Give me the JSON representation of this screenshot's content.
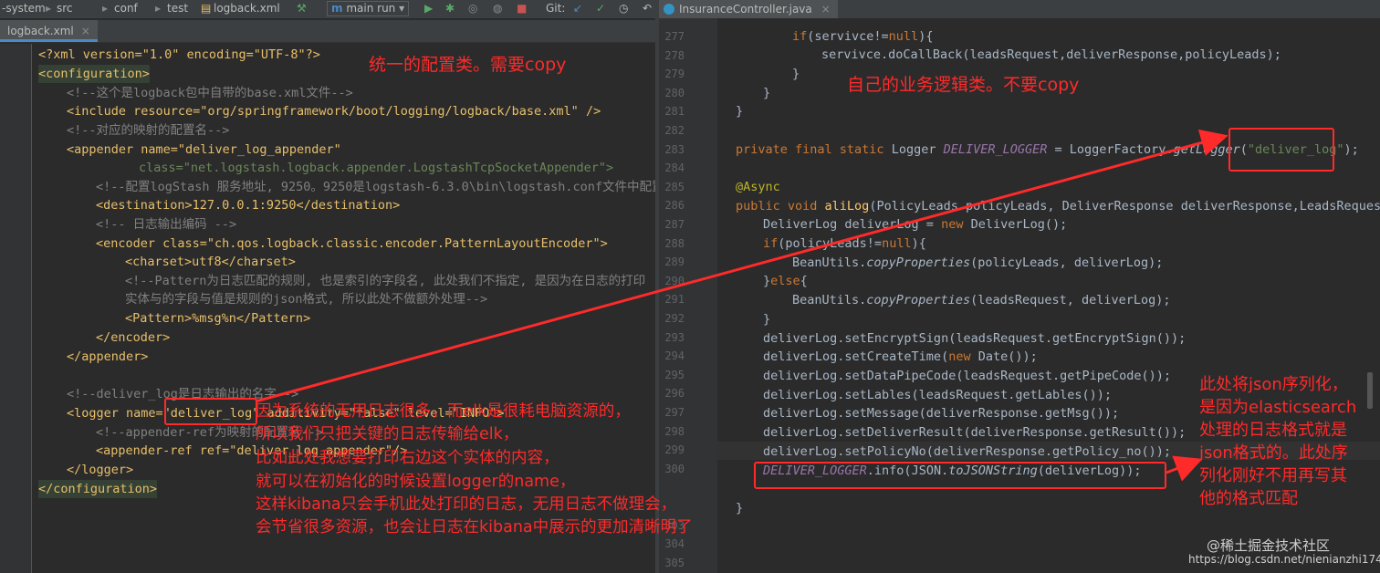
{
  "toolbar": {
    "project": "-system",
    "crumbs": [
      "src",
      "conf",
      "test"
    ],
    "file": "logback.xml",
    "run_config": "main run",
    "git_label": "Git:"
  },
  "left_tab": {
    "label": "logback.xml"
  },
  "right_tab": {
    "label": "InsuranceController.java"
  },
  "left_code": [
    "<?xml version=\"1.0\" encoding=\"UTF-8\"?>",
    "<configuration>",
    "<!--这个是logback包中自带的base.xml文件-->",
    "<include resource=\"org/springframework/boot/logging/logback/base.xml\" />",
    "<!--对应的映射的配置名-->",
    "<appender name=\"deliver_log_appender\"",
    "class=\"net.logstash.logback.appender.LogstashTcpSocketAppender\">",
    "<!--配置logStash 服务地址, 9250。9250是logstash-6.3.0\\bin\\logstash.conf文件中配置",
    "<destination>127.0.0.1:9250</destination>",
    "<!-- 日志输出编码 -->",
    "<encoder class=\"ch.qos.logback.classic.encoder.PatternLayoutEncoder\">",
    "<charset>utf8</charset>",
    "<!--Pattern为日志匹配的规则, 也是索引的字段名, 此处我们不指定, 是因为在日志的打印",
    "实体与的字段与值是规则的json格式, 所以此处不做额外处理-->",
    "<Pattern>%msg%n</Pattern>",
    "</encoder>",
    "</appender>",
    "",
    "<!--deliver_log是日志输出的名字-->",
    "<logger name=\"deliver_log\" additivity=\"false\" level=\"INFO\">",
    "<!--appender-ref为映射的配置名-->",
    "<appender-ref ref=\"deliver_log_appender\"/>",
    "</logger>",
    "</configuration>"
  ],
  "right_line_numbers": [
    "277",
    "278",
    "279",
    "280",
    "281",
    "282",
    "283",
    "284",
    "285",
    "286",
    "287",
    "288",
    "289",
    "290",
    "291",
    "292",
    "293",
    "294",
    "295",
    "296",
    "297",
    "298",
    "299",
    "300",
    "",
    "",
    "303",
    "304",
    "305"
  ],
  "right_code": [
    "if(servivce!=null){",
    "servivce.doCallBack(leadsRequest,deliverResponse,policyLeads);",
    "}",
    "}",
    "}",
    "",
    "private final static Logger DELIVER_LOGGER = LoggerFactory.getLogger(\"deliver_log\");",
    "",
    "@Async",
    "public void aliLog(PolicyLeads policyLeads, DeliverResponse deliverResponse,LeadsRequest",
    "DeliverLog deliverLog = new DeliverLog();",
    "if(policyLeads!=null){",
    "BeanUtils.copyProperties(policyLeads, deliverLog);",
    "}else{",
    "BeanUtils.copyProperties(leadsRequest, deliverLog);",
    "}",
    "deliverLog.setEncryptSign(leadsRequest.getEncryptSign());",
    "deliverLog.setCreateTime(new Date());",
    "deliverLog.setDataPipeCode(leadsRequest.getPipeCode());",
    "deliverLog.setLables(leadsRequest.getLables());",
    "deliverLog.setMessage(deliverResponse.getMsg());",
    "deliverLog.setDeliverResult(deliverResponse.getResult());",
    "deliverLog.setPolicyNo(deliverResponse.getPolicy_no());",
    "DELIVER_LOGGER.info(JSON.toJSONString(deliverLog));",
    "",
    "}"
  ],
  "annotations": {
    "left_title": "统一的配置类。需要copy",
    "right_title": "自己的业务逻辑类。不要copy",
    "explain_lines": [
      "因为系统的无用日志很多，而elk是很耗电脑资源的，",
      "所以我们只把关键的日志传输给elk，",
      "比如此处我想要打印右边这个实体的内容，",
      "就可以在初始化的时候设置logger的name，",
      "这样kibana只会手机此处打印的日志，无用日志不做理会，",
      "会节省很多资源，也会让日志在kibana中展示的更加清晰明了"
    ],
    "json_lines": [
      "此处将json序列化，",
      "是因为elasticsearch",
      "处理的日志格式就是",
      "json格式的。此处序",
      "列化刚好不用再写其",
      "他的格式匹配"
    ]
  },
  "watermark": {
    "community": "@稀土掘金技术社区",
    "url": "https://blog.csdn.net/nienianzhi1744"
  }
}
